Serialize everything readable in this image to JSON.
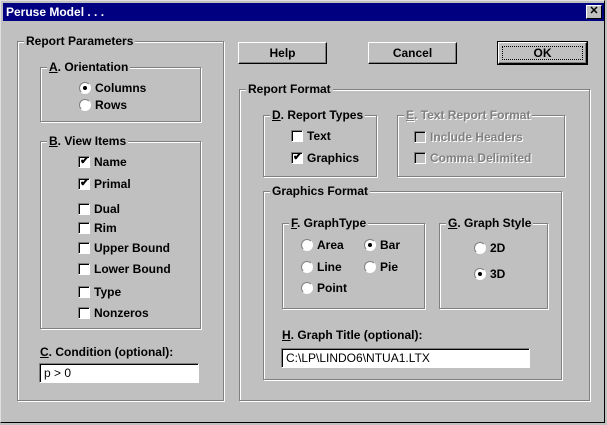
{
  "window": {
    "title": "Peruse Model . . .",
    "close_glyph": "✕"
  },
  "buttons": {
    "help": "Help",
    "cancel": "Cancel",
    "ok": "OK"
  },
  "report_parameters": {
    "title": "Report Parameters",
    "orientation": {
      "key": "A",
      "rest": ". Orientation",
      "options": [
        {
          "label": "Columns",
          "selected": true
        },
        {
          "label": "Rows",
          "selected": false
        }
      ]
    },
    "view_items": {
      "key": "B",
      "rest": ". View Items",
      "items": [
        {
          "label": "Name",
          "checked": true
        },
        {
          "label": "Primal",
          "checked": true
        },
        {
          "label": "Dual",
          "checked": false
        },
        {
          "label": "Rim",
          "checked": false
        },
        {
          "label": "Upper Bound",
          "checked": false
        },
        {
          "label": "Lower Bound",
          "checked": false
        },
        {
          "label": "Type",
          "checked": false
        },
        {
          "label": "Nonzeros",
          "checked": false
        }
      ]
    },
    "condition": {
      "key": "C",
      "rest": ". Condition (optional):",
      "value": "p > 0"
    }
  },
  "report_format": {
    "title": "Report Format",
    "report_types": {
      "key": "D",
      "rest": ". Report Types",
      "items": [
        {
          "label": "Text",
          "checked": false
        },
        {
          "label": "Graphics",
          "checked": true
        }
      ]
    },
    "text_report_format": {
      "key": "E",
      "rest": ". Text Report Format",
      "items": [
        {
          "label": "Include Headers",
          "checked": false
        },
        {
          "label": "Comma Delimited",
          "checked": false
        }
      ]
    },
    "graphics_format": {
      "title": "Graphics Format",
      "graph_type": {
        "key": "F",
        "rest": ". GraphType",
        "options": [
          {
            "label": "Area",
            "selected": false
          },
          {
            "label": "Bar",
            "selected": true
          },
          {
            "label": "Line",
            "selected": false
          },
          {
            "label": "Pie",
            "selected": false
          },
          {
            "label": "Point",
            "selected": false
          }
        ]
      },
      "graph_style": {
        "key": "G",
        "rest": ". Graph Style",
        "options": [
          {
            "label": "2D",
            "selected": false
          },
          {
            "label": "3D",
            "selected": true
          }
        ]
      },
      "graph_title": {
        "key": "H",
        "rest": ". Graph Title (optional):",
        "value": "C:\\LP\\LINDO6\\NTUA1.LTX"
      }
    }
  },
  "icons": {
    "check": "check-mark-icon",
    "radio": "radio-dot-icon",
    "close": "close-x-icon"
  }
}
